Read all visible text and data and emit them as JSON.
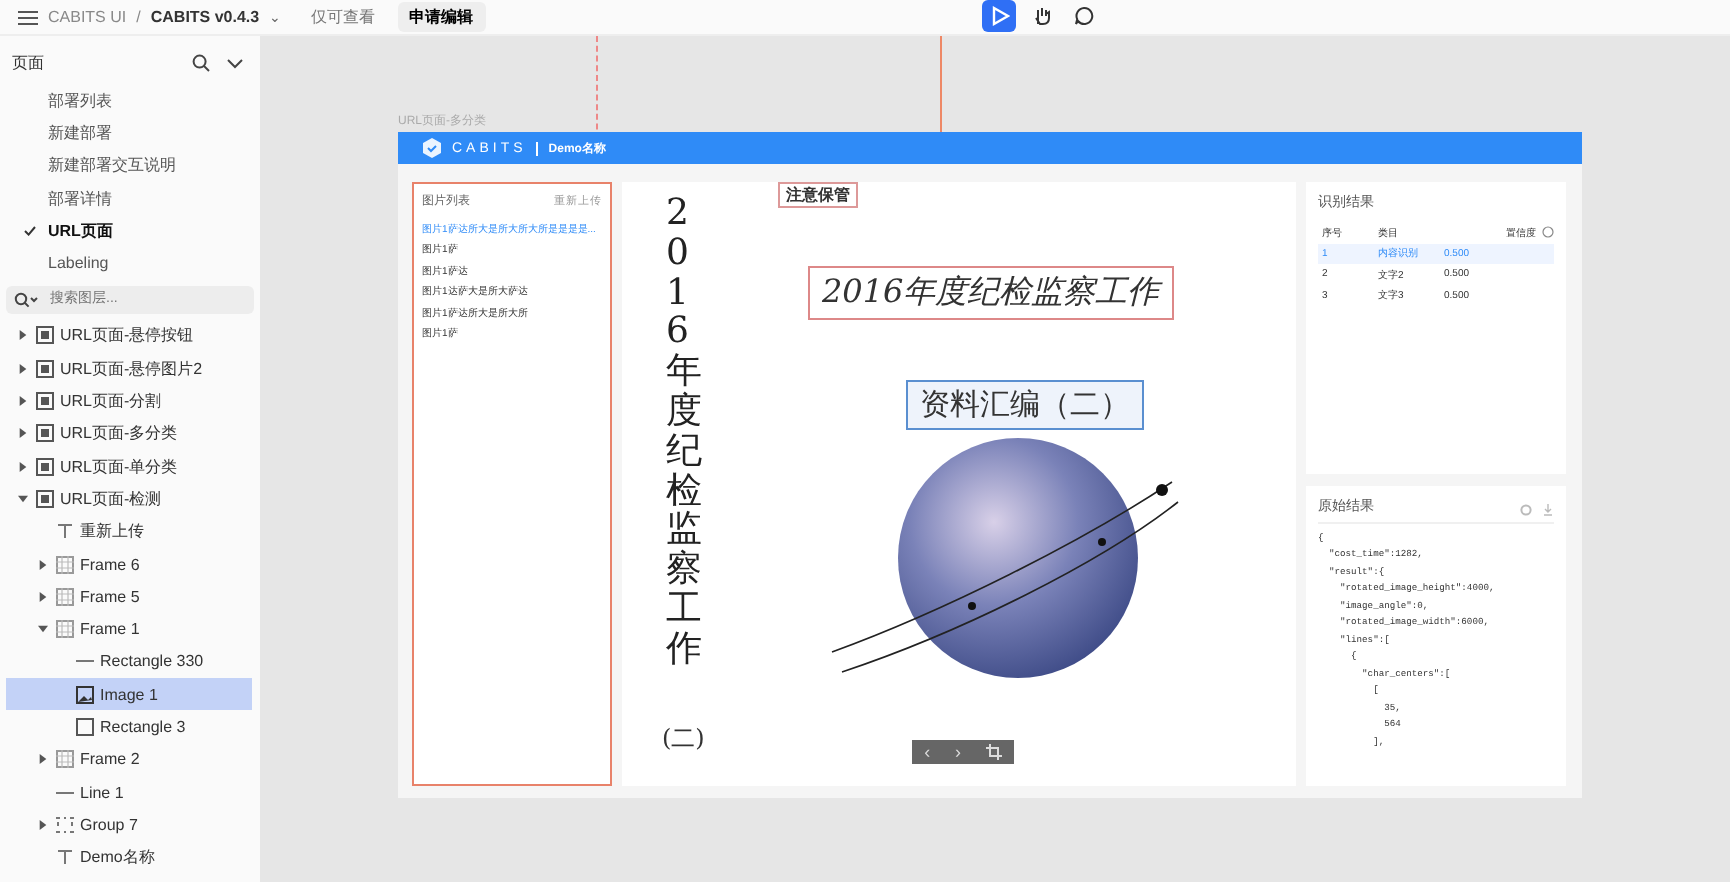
{
  "topbar": {
    "breadcrumb": [
      "CABITS UI",
      "/",
      "CABITS v0.4.3"
    ],
    "caret": "⌄",
    "mode": "仅可查看",
    "request_button": "申请编辑",
    "tools": [
      {
        "kind": "pointer",
        "selected": true
      },
      {
        "kind": "hand",
        "selected": false
      },
      {
        "kind": "comment",
        "selected": false
      }
    ]
  },
  "pages": {
    "title": "页面",
    "items": [
      {
        "label": "部署列表",
        "selected": false
      },
      {
        "label": "新建部署",
        "selected": false
      },
      {
        "label": "新建部署交互说明",
        "selected": false
      },
      {
        "label": "部署详情",
        "selected": false
      },
      {
        "label": "URL页面",
        "selected": true
      },
      {
        "label": "Labeling",
        "selected": false
      }
    ]
  },
  "layer_search": {
    "placeholder": "搜索图层..."
  },
  "layers": [
    {
      "label": "URL页面-悬停按钮",
      "kind": "frame",
      "expanded": false,
      "selected": false
    },
    {
      "label": "URL页面-悬停图片2",
      "kind": "frame",
      "expanded": false,
      "selected": false
    },
    {
      "label": "URL页面-分割",
      "kind": "frame",
      "expanded": false,
      "selected": false
    },
    {
      "label": "URL页面-多分类",
      "kind": "frame",
      "expanded": false,
      "selected": false
    },
    {
      "label": "URL页面-单分类",
      "kind": "frame",
      "expanded": false,
      "selected": false
    },
    {
      "label": "URL页面-检测",
      "kind": "frame",
      "expanded": true,
      "selected": false,
      "children": [
        {
          "label": "重新上传",
          "kind": "text",
          "selected": false
        },
        {
          "label": "Frame 6",
          "kind": "group",
          "expanded": false,
          "selected": false
        },
        {
          "label": "Frame 5",
          "kind": "group",
          "expanded": false,
          "selected": false
        },
        {
          "label": "Frame 1",
          "kind": "group",
          "expanded": true,
          "selected": false,
          "children": [
            {
              "label": "Rectangle 330",
              "kind": "line",
              "selected": false
            },
            {
              "label": "Image 1",
              "kind": "image",
              "selected": true
            },
            {
              "label": "Rectangle 3",
              "kind": "rect",
              "selected": false
            }
          ]
        },
        {
          "label": "Frame 2",
          "kind": "group",
          "expanded": false,
          "selected": false
        },
        {
          "label": "Line 1",
          "kind": "line",
          "selected": false
        },
        {
          "label": "Group 7",
          "kind": "dots",
          "expanded": false,
          "selected": false
        },
        {
          "label": "Demo名称",
          "kind": "text",
          "selected": false
        }
      ]
    }
  ],
  "canvas": {
    "frame_label": "URL页面-多分类",
    "brand": "CABITS",
    "app_name": "Demo名称",
    "image_list": {
      "title": "图片列表",
      "action": "重新上传",
      "items": [
        {
          "label": "图片1萨达所大是所大所大所是是是是...",
          "selected": true
        },
        {
          "label": "图片1萨",
          "selected": false
        },
        {
          "label": "图片1萨达",
          "selected": false
        },
        {
          "label": "图片1达萨大是所大萨达",
          "selected": false
        },
        {
          "label": "图片1萨达所大是所大所",
          "selected": false
        },
        {
          "label": "图片1萨",
          "selected": false
        }
      ]
    },
    "document": {
      "stamp": "注意保管",
      "vertical_title": "2016年度纪检监察工作",
      "vertical_sub": "(二)",
      "title": "2016年度纪检监察工作",
      "subtitle": "资料汇编（二）",
      "nav": [
        "‹",
        "›"
      ]
    },
    "recognition": {
      "title": "识别结果",
      "columns": [
        "序号",
        "类目",
        "置信度"
      ],
      "rows": [
        {
          "cells": [
            "1",
            "内容识别",
            "0.500"
          ],
          "selected": true
        },
        {
          "cells": [
            "2",
            "文字2",
            "0.500"
          ],
          "selected": false
        },
        {
          "cells": [
            "3",
            "文字3",
            "0.500"
          ],
          "selected": false
        }
      ]
    },
    "raw": {
      "title": "原始结果",
      "lines": [
        "{",
        "  \"cost_time\":1282,",
        "  \"result\":{",
        "    \"rotated_image_height\":4000,",
        "    \"image_angle\":0,",
        "    \"rotated_image_width\":6000,",
        "    \"lines\":[",
        "      {",
        "        \"char_centers\":[",
        "          [",
        "            35,",
        "            564",
        "          ],"
      ]
    }
  }
}
